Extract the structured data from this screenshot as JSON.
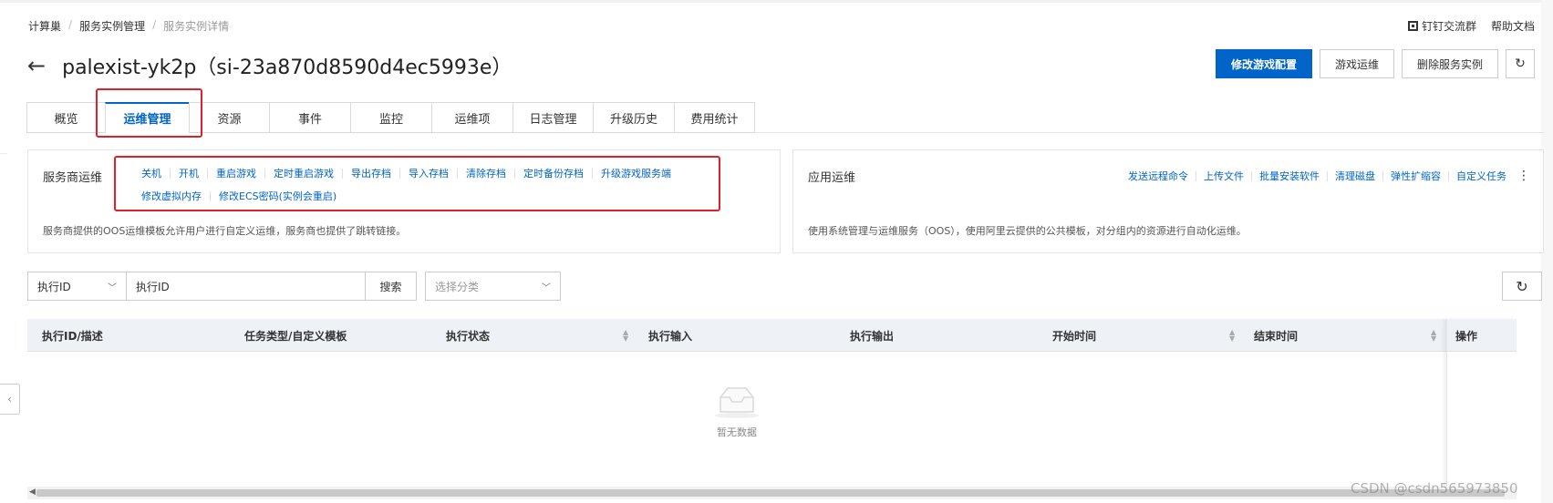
{
  "breadcrumb": {
    "items": [
      "计算巢",
      "服务实例管理",
      "服务实例详情"
    ],
    "separator": "/"
  },
  "top_links": {
    "dingtalk": "钉钉交流群",
    "help": "帮助文档"
  },
  "title": "palexist-yk2p（si-23a870d8590d4ec5993e）",
  "actions": {
    "modify_config": "修改游戏配置",
    "game_ops": "游戏运维",
    "delete_instance": "删除服务实例",
    "refresh_icon": "refresh-icon"
  },
  "tabs": [
    {
      "label": "概览"
    },
    {
      "label": "运维管理",
      "active": true
    },
    {
      "label": "资源"
    },
    {
      "label": "事件"
    },
    {
      "label": "监控"
    },
    {
      "label": "运维项"
    },
    {
      "label": "日志管理"
    },
    {
      "label": "升级历史"
    },
    {
      "label": "费用统计"
    }
  ],
  "provider_ops": {
    "title": "服务商运维",
    "links_row1": [
      "关机",
      "开机",
      "重启游戏",
      "定时重启游戏",
      "导出存档",
      "导入存档",
      "清除存档",
      "定时备份存档",
      "升级游戏服务端"
    ],
    "links_row2": [
      "修改虚拟内存",
      "修改ECS密码(实例会重启)"
    ],
    "description": "服务商提供的OOS运维模板允许用户进行自定义运维，服务商也提供了跳转链接。"
  },
  "app_ops": {
    "title": "应用运维",
    "links": [
      "发送远程命令",
      "上传文件",
      "批量安装软件",
      "清理磁盘",
      "弹性扩缩容",
      "自定义任务"
    ],
    "more_icon": "more-vertical-icon",
    "description": "使用系统管理与运维服务（OOS），使用阿里云提供的公共模板，对分组内的资源进行自动化运维。"
  },
  "filter": {
    "field_select": "执行ID",
    "input_placeholder": "执行ID",
    "search_label": "搜索",
    "category_placeholder": "选择分类"
  },
  "table": {
    "columns": [
      "执行ID/描述",
      "任务类型/自定义模板",
      "执行状态",
      "执行输入",
      "执行输出",
      "开始时间",
      "结束时间",
      "操作"
    ],
    "empty_text": "暂无数据"
  },
  "watermark": "CSDN @csdn565973850",
  "accent_color": "#0064c8",
  "highlight_color": "#e0202a"
}
